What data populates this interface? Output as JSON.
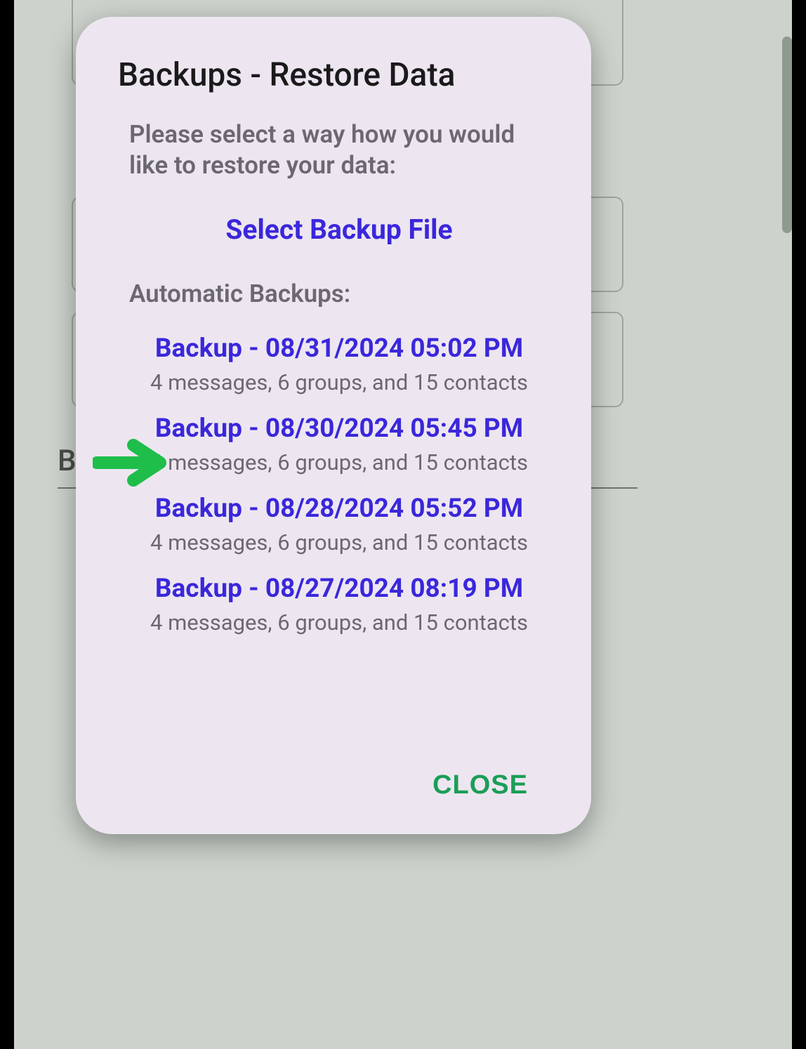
{
  "background": {
    "visible_label": "Bac"
  },
  "dialog": {
    "title": "Backups - Restore Data",
    "instruction": "Please select a way how you would like to restore your data:",
    "select_file_label": "Select Backup File",
    "auto_heading": "Automatic Backups:",
    "backups": [
      {
        "title": "Backup - 08/31/2024 05:02 PM",
        "subtitle": "4 messages, 6 groups, and 15 contacts"
      },
      {
        "title": "Backup - 08/30/2024 05:45 PM",
        "subtitle": "4 messages, 6 groups, and 15 contacts"
      },
      {
        "title": "Backup - 08/28/2024 05:52 PM",
        "subtitle": "4 messages, 6 groups, and 15 contacts"
      },
      {
        "title": "Backup - 08/27/2024 08:19 PM",
        "subtitle": "4 messages, 6 groups, and 15 contacts"
      }
    ],
    "close_label": "CLOSE"
  },
  "annotation": {
    "arrow_color": "#1fbe4b",
    "highlighted_backup_index": 1
  }
}
